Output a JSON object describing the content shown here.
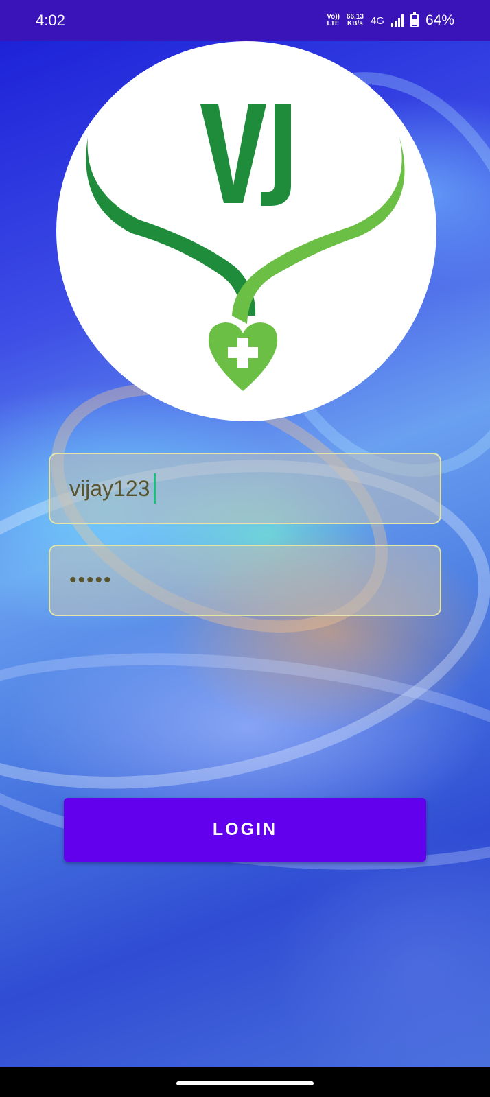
{
  "status_bar": {
    "time": "4:02",
    "volte_top": "Vo))",
    "volte_bottom": "LTE",
    "speed_value": "66.13",
    "speed_unit": "KB/s",
    "network": "4G",
    "battery_percent": "64%",
    "battery_level": 0.64
  },
  "logo": {
    "text": "VJ",
    "primary_color": "#1e8c3a",
    "secondary_color": "#6cbf45"
  },
  "login_form": {
    "username_value": "vijay123",
    "password_masked": "•••••",
    "login_label": "LOGIN",
    "button_color": "#6200ee",
    "field_border_color": "#e3e6a8"
  }
}
